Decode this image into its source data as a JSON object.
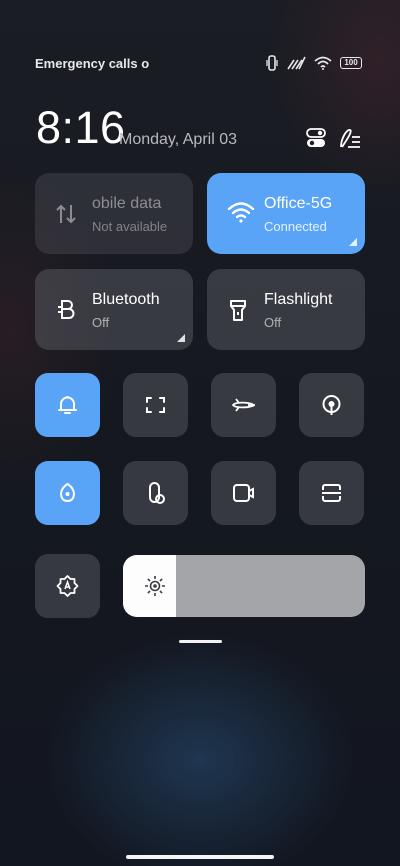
{
  "status_bar": {
    "carrier_text": "Emergency calls o",
    "battery_level": "100",
    "icons": [
      "vibrate-icon",
      "no-signal-icon",
      "wifi-icon",
      "battery-icon"
    ]
  },
  "header": {
    "time": "8:16",
    "date": "Monday, April 03",
    "buttons": [
      "toggles-icon",
      "edit-icon"
    ]
  },
  "tiles": {
    "mobile_data": {
      "title": "obile data",
      "subtitle": "Not available",
      "state": "unavailable"
    },
    "wifi": {
      "title": "Office-5G",
      "subtitle": "Connected",
      "state": "on"
    },
    "bluetooth": {
      "title": "Bluetooth",
      "subtitle": "Off",
      "state": "off"
    },
    "flashlight": {
      "title": "Flashlight",
      "subtitle": "Off",
      "state": "off"
    }
  },
  "quick_toggles": [
    {
      "name": "notification-bell",
      "icon": "bell-icon",
      "active": true
    },
    {
      "name": "screenshot",
      "icon": "screenshot-icon",
      "active": false
    },
    {
      "name": "airplane-mode",
      "icon": "airplane-icon",
      "active": false
    },
    {
      "name": "location",
      "icon": "location-pin-icon",
      "active": false
    },
    {
      "name": "eye-comfort",
      "icon": "leaf-icon",
      "active": true
    },
    {
      "name": "dark-mode",
      "icon": "dark-mode-icon",
      "active": false
    },
    {
      "name": "screen-recorder",
      "icon": "video-camera-icon",
      "active": false
    },
    {
      "name": "scanner",
      "icon": "scanner-icon",
      "active": false
    }
  ],
  "brightness": {
    "auto_icon": "auto-brightness-icon",
    "level": 0.22
  },
  "colors": {
    "accent": "#5aa4f8",
    "tile": "#3a3c44",
    "slider_fill": "#fdfdfd",
    "slider_track": "#a4a5a9"
  }
}
